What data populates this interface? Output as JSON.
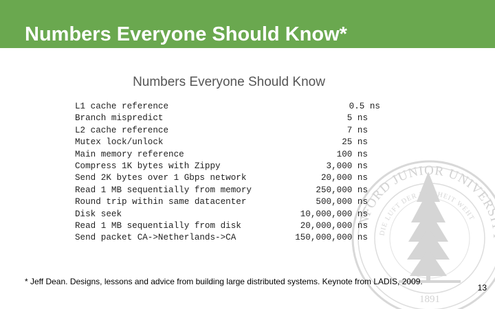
{
  "slide": {
    "title": "Numbers Everyone Should Know*",
    "table_heading": "Numbers Everyone Should Know",
    "rows": [
      {
        "operation": "L1 cache reference",
        "value": "0.5 ns"
      },
      {
        "operation": "Branch mispredict",
        "value": "5 ns"
      },
      {
        "operation": "L2 cache reference",
        "value": "7 ns"
      },
      {
        "operation": "Mutex lock/unlock",
        "value": "25 ns"
      },
      {
        "operation": "Main memory reference",
        "value": "100 ns"
      },
      {
        "operation": "Compress 1K bytes with Zippy",
        "value": "3,000 ns"
      },
      {
        "operation": "Send 2K bytes over 1 Gbps network",
        "value": "20,000 ns"
      },
      {
        "operation": "Read 1 MB sequentially from memory",
        "value": "250,000 ns"
      },
      {
        "operation": "Round trip within same datacenter",
        "value": "500,000 ns"
      },
      {
        "operation": "Disk seek",
        "value": "10,000,000 ns"
      },
      {
        "operation": "Read 1 MB sequentially from disk",
        "value": "20,000,000 ns"
      },
      {
        "operation": "Send packet CA->Netherlands->CA",
        "value": "150,000,000 ns"
      }
    ],
    "footnote": "* Jeff Dean. Designs, lessons and advice from building large distributed systems. Keynote from LADIS, 2009.",
    "page_number": "13"
  },
  "watermark": {
    "icon": "university-seal-icon",
    "ring_text_top": "NFORD JUNIOR UNIVERSITY",
    "ring_text_inner": "DIE LUFT DER FREIHEIT WEHT",
    "year": "1891"
  },
  "colors": {
    "title_bar": "#6aa84f",
    "title_text": "#ffffff",
    "heading_text": "#555555",
    "watermark": "#d8d8d8"
  }
}
